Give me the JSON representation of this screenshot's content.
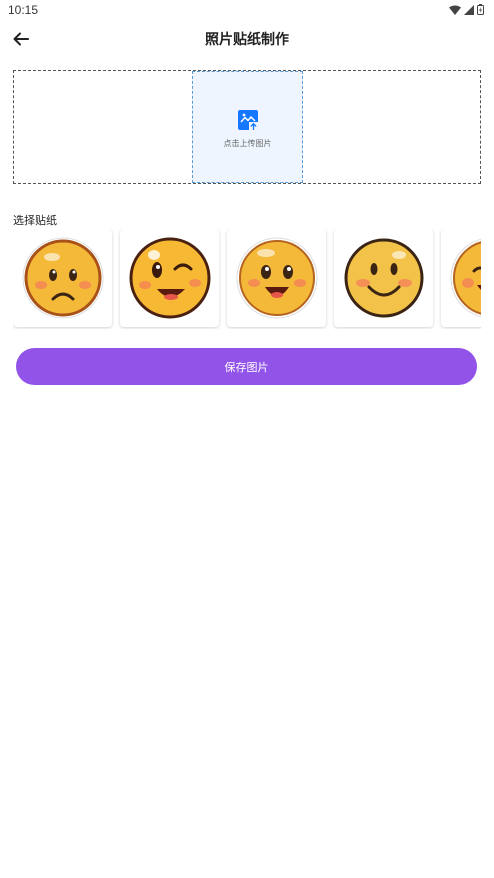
{
  "status_bar": {
    "time": "10:15",
    "icons": [
      "wifi-icon",
      "signal-icon",
      "battery-icon"
    ]
  },
  "header": {
    "title": "照片贴纸制作",
    "back_icon": "arrow-left-icon"
  },
  "upload": {
    "label": "点击上传图片",
    "icon": "image-upload-icon",
    "accent_color": "#1677ff"
  },
  "stickers": {
    "section_label": "选择贴纸",
    "items": [
      {
        "name": "sad-emoji"
      },
      {
        "name": "wink-emoji"
      },
      {
        "name": "happy-blush-emoji"
      },
      {
        "name": "smile-emoji"
      },
      {
        "name": "laughing-emoji"
      }
    ]
  },
  "actions": {
    "save_label": "保存图片",
    "save_color": "#9254e8"
  }
}
